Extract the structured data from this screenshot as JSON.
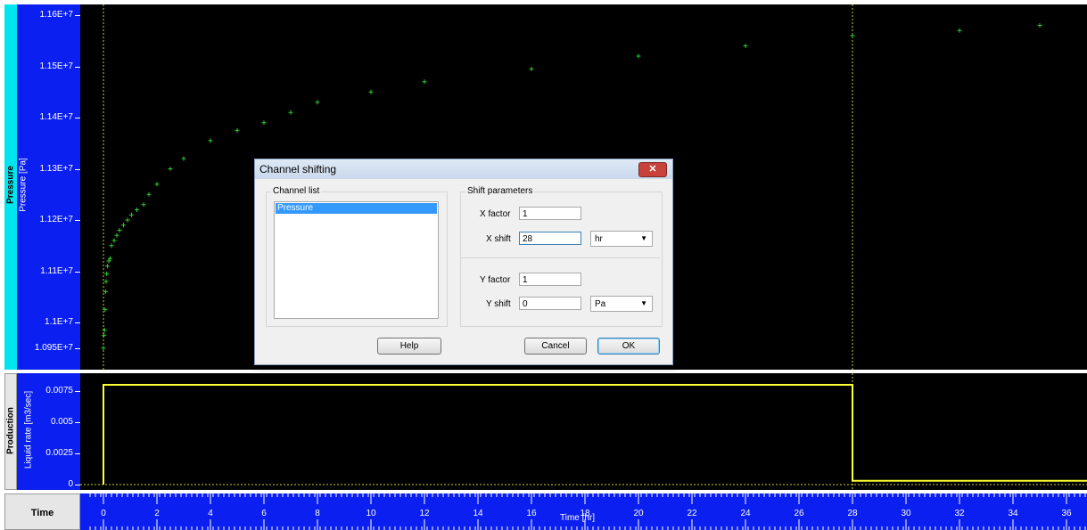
{
  "panels": {
    "pressure": {
      "channel_label": "Pressure",
      "axis_label": "Pressure [Pa]",
      "y_ticks": [
        "1.16E+7",
        "1.15E+7",
        "1.14E+7",
        "1.13E+7",
        "1.12E+7",
        "1.11E+7",
        "1.1E+7",
        "1.095E+7"
      ]
    },
    "production": {
      "channel_label": "Production",
      "axis_label": "Liquid rate [m3/sec]",
      "y_ticks": [
        "0.0075",
        "0.005",
        "0.0025",
        "0"
      ]
    },
    "time": {
      "channel_label": "Time",
      "axis_label": "Time [hr]",
      "x_ticks": [
        "0",
        "2",
        "4",
        "6",
        "8",
        "10",
        "12",
        "14",
        "16",
        "18",
        "20",
        "22",
        "24",
        "26",
        "28",
        "30",
        "32",
        "34",
        "36"
      ]
    }
  },
  "colors": {
    "plot_background": "#000000",
    "axis_background": "#0a1ff0",
    "channel_strip": "#00e5ee",
    "data_points": "#2ecc2e",
    "rate_line": "#ffff33"
  },
  "chart_data": [
    {
      "type": "scatter",
      "title": "",
      "xlabel": "Time [hr]",
      "ylabel": "Pressure [Pa]",
      "xlim": [
        -0.5,
        36.8
      ],
      "ylim": [
        10950000,
        11610000
      ],
      "series": [
        {
          "x": [
            0,
            0.02,
            0.04,
            0.06,
            0.08,
            0.1,
            0.12,
            0.15,
            0.2,
            0.25,
            0.3,
            0.4,
            0.5,
            0.6,
            0.75,
            0.9,
            1.05,
            1.25,
            1.5,
            1.7,
            2,
            2.5,
            3,
            4,
            5,
            6,
            7,
            8,
            10,
            12,
            16,
            20,
            24,
            28,
            32,
            35
          ],
          "y": [
            10950000,
            10975000,
            10985000,
            11025000,
            11060000,
            11080000,
            11095000,
            11110000,
            11120000,
            11125000,
            11150000,
            11160000,
            11170000,
            11180000,
            11190000,
            11200000,
            11210000,
            11220000,
            11230000,
            11250000,
            11270000,
            11300000,
            11320000,
            11355000,
            11375000,
            11390000,
            11410000,
            11430000,
            11450000,
            11470000,
            11495000,
            11520000,
            11540000,
            11560000,
            11570000,
            11580000
          ]
        }
      ]
    },
    {
      "type": "line",
      "title": "",
      "xlabel": "Time [hr]",
      "ylabel": "Liquid rate [m3/sec]",
      "xlim": [
        -0.5,
        36.8
      ],
      "ylim": [
        0,
        0.0085
      ],
      "series": [
        {
          "x": [
            0,
            0,
            28,
            28,
            36.8
          ],
          "y": [
            0,
            0.008,
            0.008,
            0.0003,
            0.0003
          ]
        }
      ]
    }
  ],
  "dialog": {
    "title": "Channel shifting",
    "close_symbol": "✕",
    "channel_list_label": "Channel list",
    "channel_items": [
      "Pressure"
    ],
    "shift_parameters_label": "Shift parameters",
    "x_factor_label": "X factor",
    "x_factor_value": "1",
    "x_shift_label": "X shift",
    "x_shift_value": "28",
    "x_unit": "hr",
    "y_factor_label": "Y factor",
    "y_factor_value": "1",
    "y_shift_label": "Y shift",
    "y_shift_value": "0",
    "y_unit": "Pa",
    "help_label": "Help",
    "cancel_label": "Cancel",
    "ok_label": "OK"
  }
}
